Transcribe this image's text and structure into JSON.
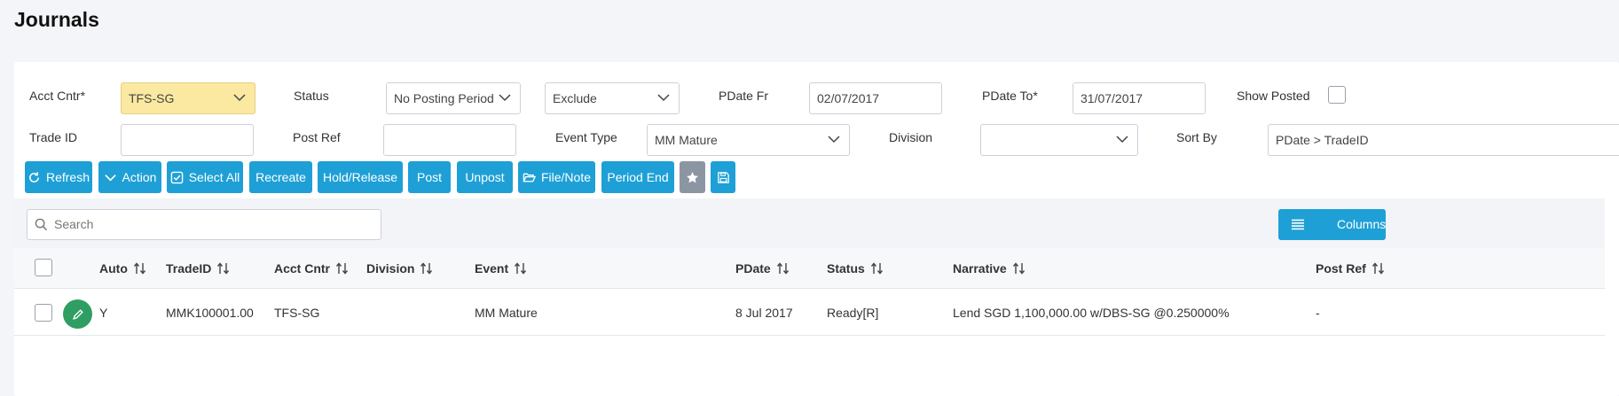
{
  "page": {
    "title": "Journals"
  },
  "filters": {
    "acct_cntr": {
      "label": "Acct Cntr*",
      "value": "TFS-SG"
    },
    "status": {
      "label": "Status",
      "value": "No Posting Period",
      "secondary_value": "Exclude"
    },
    "pdate_fr": {
      "label": "PDate Fr",
      "value": "02/07/2017"
    },
    "pdate_to": {
      "label": "PDate To*",
      "value": "31/07/2017"
    },
    "show_posted": {
      "label": "Show Posted",
      "checked": false
    },
    "trade_id": {
      "label": "Trade ID",
      "value": ""
    },
    "post_ref": {
      "label": "Post Ref",
      "value": ""
    },
    "event_type": {
      "label": "Event Type",
      "value": "MM Mature"
    },
    "division": {
      "label": "Division",
      "value": ""
    },
    "sort_by": {
      "label": "Sort By",
      "value": "PDate > TradeID"
    }
  },
  "toolbar": {
    "refresh": "Refresh",
    "action": "Action",
    "select_all": "Select All",
    "recreate": "Recreate",
    "hold_release": "Hold/Release",
    "post": "Post",
    "unpost": "Unpost",
    "file_note": "File/Note",
    "period_end": "Period End",
    "accent_color": "#1ea0d6",
    "secondary_color": "#8c96a3"
  },
  "grid": {
    "search_placeholder": "Search",
    "columns_button": "Columns",
    "headers": [
      "Auto",
      "TradeID",
      "Acct Cntr",
      "Division",
      "Event",
      "PDate",
      "Status",
      "Narrative",
      "Post Ref"
    ],
    "rows": [
      {
        "auto": "Y",
        "trade_id": "MMK100001.00",
        "acct_cntr": "TFS-SG",
        "division": "",
        "event": "MM Mature",
        "pdate": "8 Jul 2017",
        "status": "Ready[R]",
        "narrative": "Lend SGD 1,100,000.00 w/DBS-SG @0.250000%",
        "post_ref": "-"
      }
    ]
  },
  "icons": {
    "refresh": "refresh-icon",
    "action": "chevron-down-icon",
    "select_all": "checkbox-icon",
    "file_note": "folder-open-icon",
    "favorite": "star-icon",
    "save": "save-icon",
    "search": "search-icon",
    "columns": "list-icon",
    "sort": "sort-icon",
    "edit": "pencil-icon"
  }
}
